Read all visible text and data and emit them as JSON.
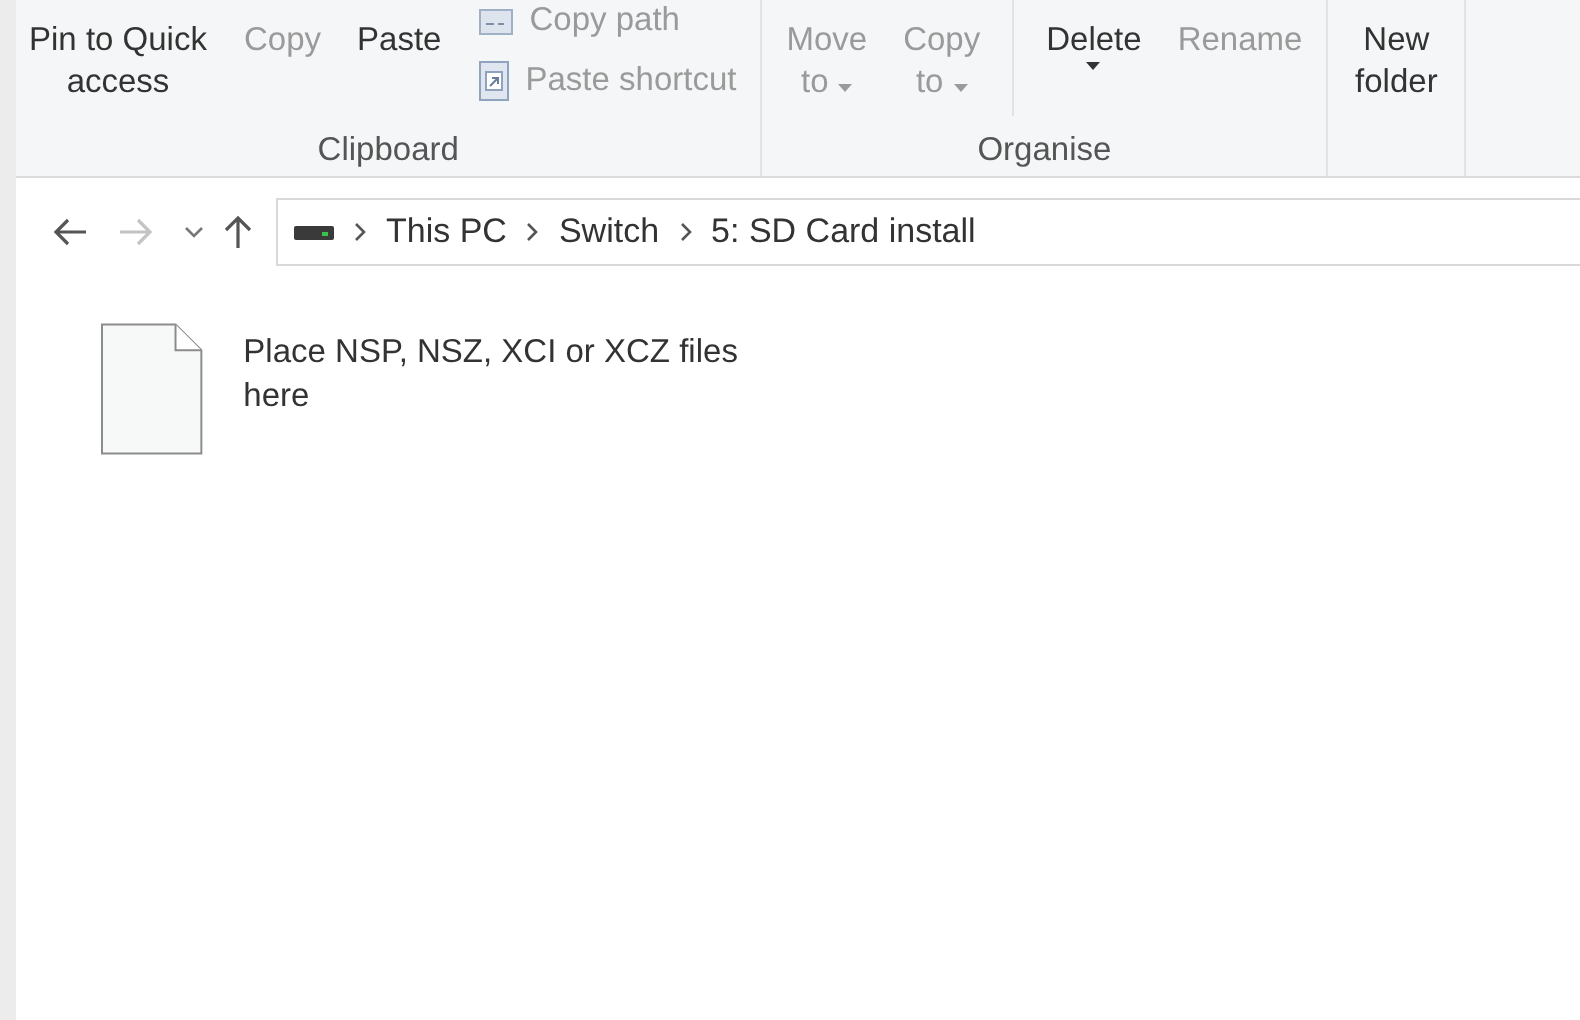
{
  "ribbon": {
    "groups": [
      {
        "label": "Clipboard",
        "items": [
          {
            "kind": "large",
            "label": "Pin to Quick access",
            "disabled": false
          },
          {
            "kind": "large",
            "label": "Copy",
            "disabled": true
          },
          {
            "kind": "large",
            "label": "Paste",
            "disabled": false
          },
          {
            "kind": "stack",
            "items": [
              {
                "label": "Copy path",
                "disabled": true
              },
              {
                "label": "Paste shortcut",
                "disabled": true
              }
            ]
          }
        ]
      },
      {
        "label": "Organise",
        "items": [
          {
            "kind": "split",
            "label": "Move",
            "sub": "to",
            "disabled": true
          },
          {
            "kind": "split",
            "label": "Copy",
            "sub": "to",
            "disabled": true
          },
          {
            "kind": "divider"
          },
          {
            "kind": "caret",
            "label": "Delete",
            "disabled": false
          },
          {
            "kind": "large",
            "label": "Rename",
            "disabled": true
          }
        ]
      },
      {
        "items": [
          {
            "kind": "large",
            "label": "New folder",
            "disabled": false
          }
        ]
      }
    ]
  },
  "navigation": {
    "back": {
      "disabled": false
    },
    "forward": {
      "disabled": true
    },
    "up": {
      "disabled": false
    }
  },
  "address": {
    "crumbs": [
      "This PC",
      "Switch",
      "5: SD Card install"
    ]
  },
  "files": [
    {
      "name": "Place NSP, NSZ, XCI or XCZ files here",
      "selected": false
    }
  ]
}
